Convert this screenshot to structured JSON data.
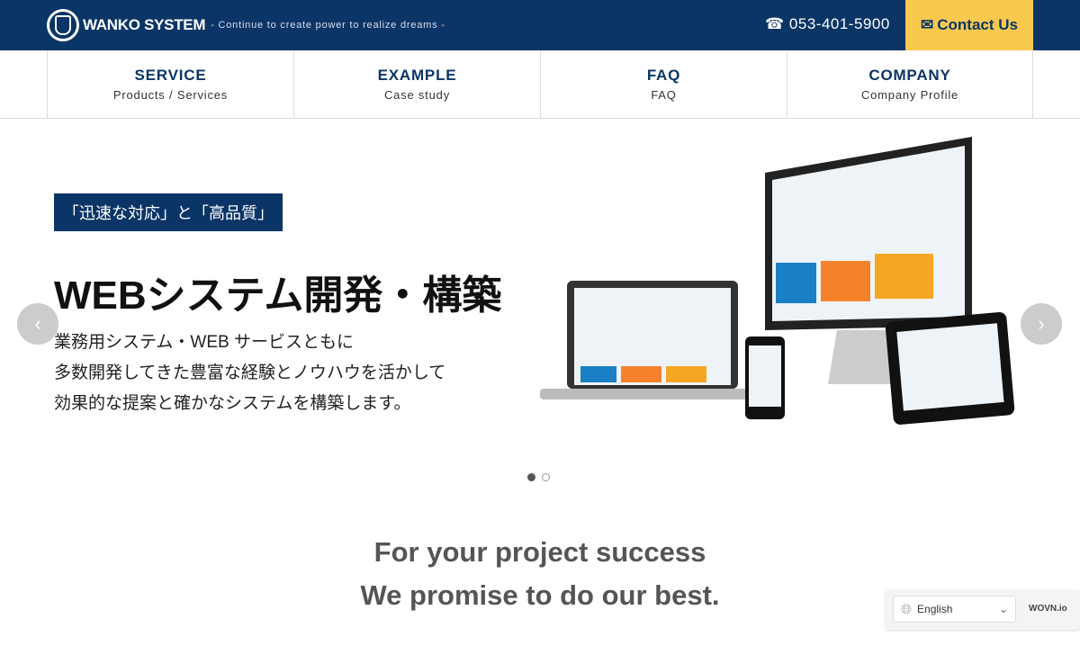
{
  "header": {
    "brand": "WANKO SYSTEM",
    "tagline": "- Continue to create power to realize dreams -",
    "phone": "053-401-5900",
    "contact": "Contact Us"
  },
  "nav": [
    {
      "title": "SERVICE",
      "sub": "Products / Services"
    },
    {
      "title": "EXAMPLE",
      "sub": "Case study"
    },
    {
      "title": "FAQ",
      "sub": "FAQ"
    },
    {
      "title": "COMPANY",
      "sub": "Company Profile"
    }
  ],
  "hero": {
    "badge": "「迅速な対応」と「高品質」",
    "title": "WEBシステム開発・構築",
    "lines": [
      "業務用システム・WEB サービスともに",
      "多数開発してきた豊富な経験とノウハウを活かして",
      "効果的な提案と確かなシステムを構築します。"
    ],
    "slide_count": 2,
    "active_slide": 1
  },
  "promise": {
    "line1": "For your project success",
    "line2": "We promise to do our best."
  },
  "language": {
    "selected": "English",
    "provider": "WOVN.io"
  }
}
